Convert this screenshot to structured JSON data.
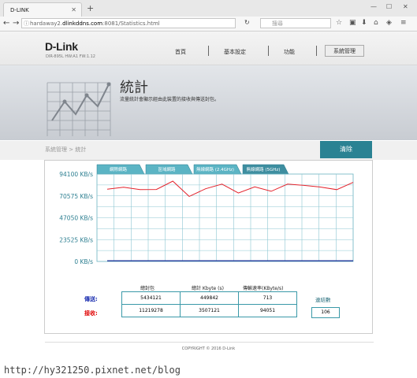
{
  "browser": {
    "tab_title": "D-LINK",
    "url_prefix": "hardaway2.",
    "url_domain": "dlinkddns.com",
    "url_suffix": ":8081/Statistics.html",
    "search_placeholder": "搜尋"
  },
  "header": {
    "logo": "D-Link",
    "model_info": "DIR-895L HW:A1 FW:1.12",
    "menu": [
      "首頁",
      "基本設定",
      "功能",
      "系統管理"
    ]
  },
  "banner": {
    "title": "統計",
    "description": "流量統計會顯示經由此裝置的接收與傳送封包。"
  },
  "breadcrumb": "系統管理 > 統計",
  "clear_button": "清除",
  "chart_data": {
    "type": "line",
    "tabs": [
      "網際網路",
      "區域網路",
      "無線網路 (2.4GHz)",
      "無線網路 (5GHz)"
    ],
    "active_tab": 3,
    "y_tick_labels": [
      "94100 KB/s",
      "70575 KB/s",
      "47050 KB/s",
      "23525 KB/s",
      "0 KB/s"
    ],
    "ylim": [
      0,
      94100
    ],
    "grid": true,
    "x": [
      1,
      2,
      3,
      4,
      5,
      6,
      7,
      8,
      9,
      10,
      11,
      12,
      13,
      14
    ],
    "series": [
      {
        "color": "#e4222b",
        "values": [
          85400,
          87900,
          85000,
          85200,
          95000,
          77000,
          86000,
          91500,
          81000,
          88200,
          83000,
          91500,
          90000,
          88000,
          85000,
          93500
        ]
      },
      {
        "color": "#243a9c",
        "values": [
          700,
          700,
          700,
          700,
          700,
          700,
          700,
          700,
          700,
          700,
          700,
          700,
          700,
          700,
          700,
          700
        ]
      }
    ]
  },
  "stats": {
    "headers": [
      "總封包",
      "總計 Kbyte (s)",
      "傳輸速率(KByte/s)"
    ],
    "rows": [
      {
        "label": "傳送:",
        "color": "#1c2fb0",
        "values": [
          "5434121",
          "449842",
          "713"
        ]
      },
      {
        "label": "接收:",
        "color": "#e00000",
        "values": [
          "11219278",
          "3507121",
          "94051"
        ]
      }
    ],
    "connections_label": "連結數",
    "connections_value": "106"
  },
  "copyright": "COPYRIGHT © 2016 D-Link",
  "watermark": "http://hy321250.pixnet.net/blog"
}
